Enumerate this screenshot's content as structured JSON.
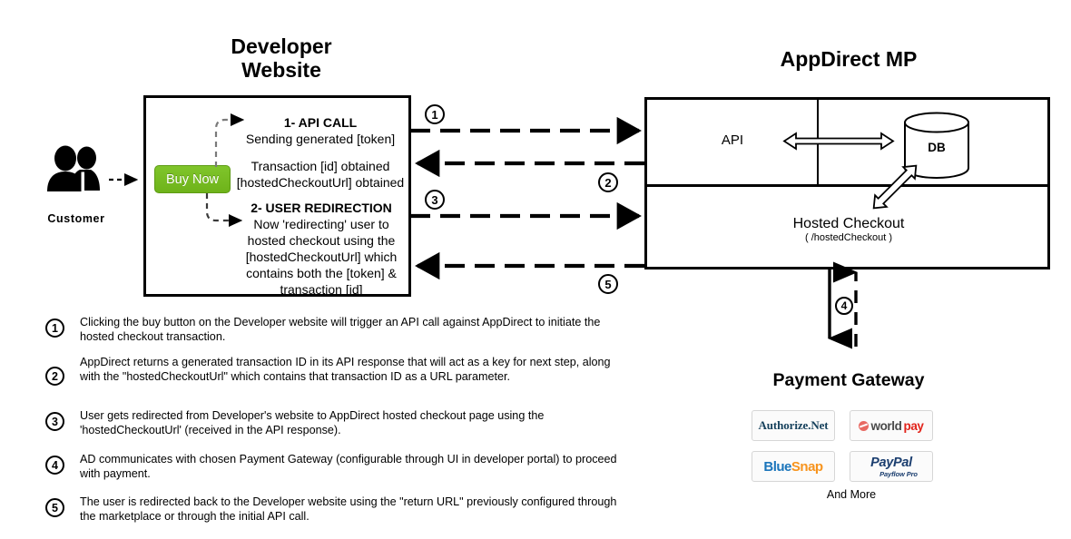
{
  "diagram": {
    "titles": {
      "developer_website": "Developer\nWebsite",
      "developer_website_line1": "Developer",
      "developer_website_line2": "Website",
      "appdirect_mp": "AppDirect MP",
      "payment_gateway": "Payment Gateway"
    },
    "customer": {
      "label": "Customer",
      "icon": "two-people-icon"
    },
    "developer_box": {
      "buy_now_button": "Buy Now",
      "step1_title": "1- API CALL",
      "step1_body": "Sending generated [token]",
      "response_line1": "Transaction [id] obtained",
      "response_line2": "[hostedCheckoutUrl] obtained",
      "step2_title": "2- USER REDIRECTION",
      "step2_body": "Now 'redirecting' user to hosted checkout using the [hostedCheckoutUrl] which contains both the [token] & transaction [id]"
    },
    "appdirect_box": {
      "api_label": "API",
      "db_label": "DB",
      "hosted_checkout_label": "Hosted Checkout",
      "hosted_checkout_path": "( /hostedCheckout )"
    },
    "flow_markers": {
      "m1": "1",
      "m2": "2",
      "m3": "3",
      "m4": "4",
      "m5": "5"
    },
    "legend": [
      {
        "number": "1",
        "text": "Clicking the buy button on the Developer website will trigger an API call against AppDirect to initiate the hosted checkout transaction."
      },
      {
        "number": "2",
        "text": "AppDirect returns a generated transaction ID in its API response that will act as a key for next step, along with the \"hostedCheckoutUrl\" which contains that transaction ID as a URL parameter."
      },
      {
        "number": "3",
        "text": "User gets redirected from Developer's website to AppDirect hosted checkout page using the 'hostedCheckoutUrl' (received in the API response)."
      },
      {
        "number": "4",
        "text": "AD communicates with chosen Payment Gateway (configurable through UI in developer portal) to proceed with payment."
      },
      {
        "number": "5",
        "text": "The user is redirected back to the Developer website using the \"return URL\" previously configured through the marketplace or through the initial API call."
      }
    ],
    "payment_gateways": {
      "logos": [
        {
          "name": "Authorize.Net",
          "part1": "Authorize.Net",
          "part2": ""
        },
        {
          "name": "worldpay",
          "part1": "world",
          "part2": "pay"
        },
        {
          "name": "BlueSnap",
          "part1": "Blue",
          "part2": "Snap"
        },
        {
          "name": "PayPal Payflow Pro",
          "part1": "PayPal",
          "part2": "Payflow Pro"
        }
      ],
      "and_more": "And More"
    },
    "colors": {
      "buy_now_green": "#76bc21",
      "stroke_black": "#000000",
      "worldpay_red": "#e2231a",
      "bluesnap_blue": "#1b75bb",
      "bluesnap_orange": "#f7941e",
      "paypal_navy": "#1b3e6f",
      "authorizenet_navy": "#16415c",
      "background": "#ffffff"
    }
  }
}
